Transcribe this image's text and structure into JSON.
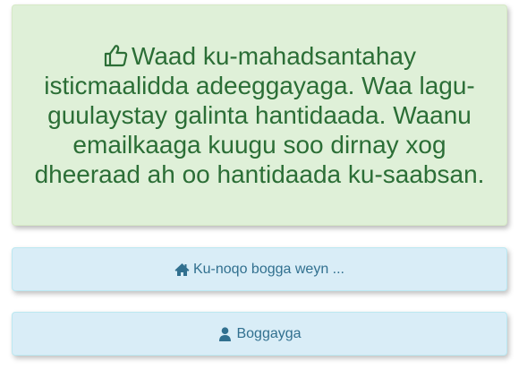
{
  "alert": {
    "icon": "thumbs-up-icon",
    "message": "Waad ku-mahadsantahay isticmaalidda adeeggayaga. Waa lagu-guulaystay galinta hantidaada. Waanu emailkaaga kuugu soo dirnay xog dheeraad ah oo hantidaada ku-saabsan.",
    "text_color": "#2b6e36",
    "background_color": "#dff0d8"
  },
  "buttons": {
    "home": {
      "icon": "home-icon",
      "label": "Ku-noqo bogga weyn ..."
    },
    "profile": {
      "icon": "user-icon",
      "label": "Boggayga"
    },
    "text_color": "#31708f",
    "background_color": "#d9edf7"
  }
}
